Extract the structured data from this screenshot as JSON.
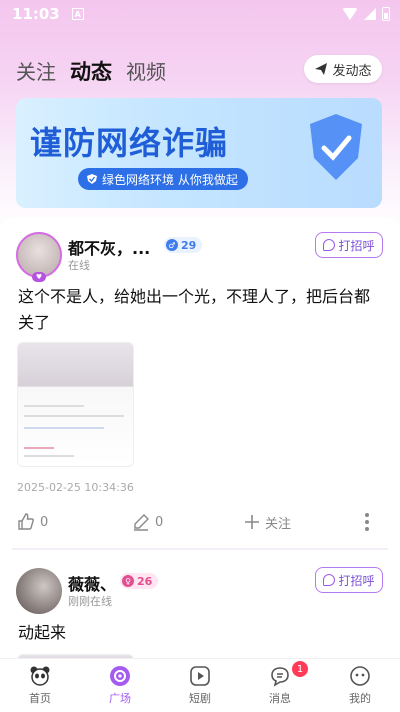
{
  "status_bar": {
    "time": "11:03",
    "notification_icon": "A"
  },
  "header": {
    "tabs": [
      {
        "label": "关注",
        "active": false
      },
      {
        "label": "动态",
        "active": true
      },
      {
        "label": "视频",
        "active": false
      }
    ],
    "post_button_label": "发动态"
  },
  "banner": {
    "title": "谨防网络诈骗",
    "pill_text": "绿色网络环境  从你我做起"
  },
  "posts": [
    {
      "user_name": "都不灰，...",
      "level": "29",
      "status": "在线",
      "greet_label": "打招呼",
      "content": "这个不是人，给她出一个光，不理人了，把后台都关了",
      "timestamp": "2025-02-25 10:34:36",
      "likes": "0",
      "comments": "0",
      "follow_label": "关注"
    },
    {
      "user_name": "薇薇、",
      "level": "26",
      "status": "刚刚在线",
      "greet_label": "打招呼",
      "content": "动起来"
    }
  ],
  "bottom_nav": [
    {
      "label": "首页",
      "icon": "panda-icon"
    },
    {
      "label": "广场",
      "icon": "plaza-icon",
      "active": true
    },
    {
      "label": "短剧",
      "icon": "play-icon"
    },
    {
      "label": "消息",
      "icon": "message-icon",
      "badge": "1"
    },
    {
      "label": "我的",
      "icon": "profile-face-icon"
    }
  ],
  "colors": {
    "accent": "#a45cf0",
    "banner_blue": "#1f5ed6",
    "badge_red": "#ff3b57"
  }
}
